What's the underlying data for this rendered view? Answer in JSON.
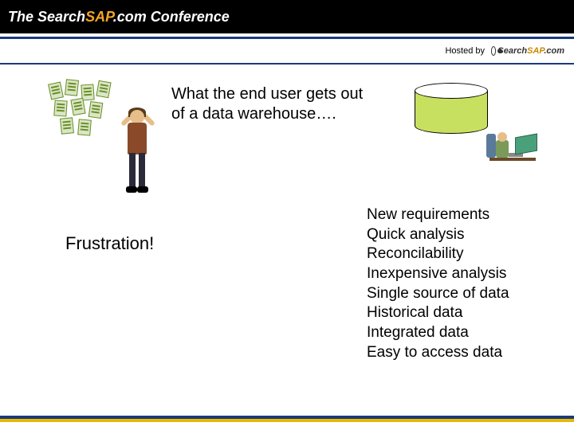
{
  "header": {
    "brand_prefix": "The ",
    "brand_search": "Search",
    "brand_sap": "SAP",
    "brand_suffix": ".com",
    "brand_conference": " Conference"
  },
  "hosted": {
    "label": "Hosted by",
    "logo_search": "Search",
    "logo_sap": "SAP",
    "logo_suffix": ".com"
  },
  "slide": {
    "title_line1": "What the end user gets out",
    "title_line2": "of a data warehouse….",
    "frustration": "Frustration!",
    "benefits": [
      "New requirements",
      "Quick analysis",
      "Reconcilability",
      "Inexpensive analysis",
      "Single source of data",
      "Historical data",
      "Integrated data",
      "Easy to access data"
    ]
  }
}
